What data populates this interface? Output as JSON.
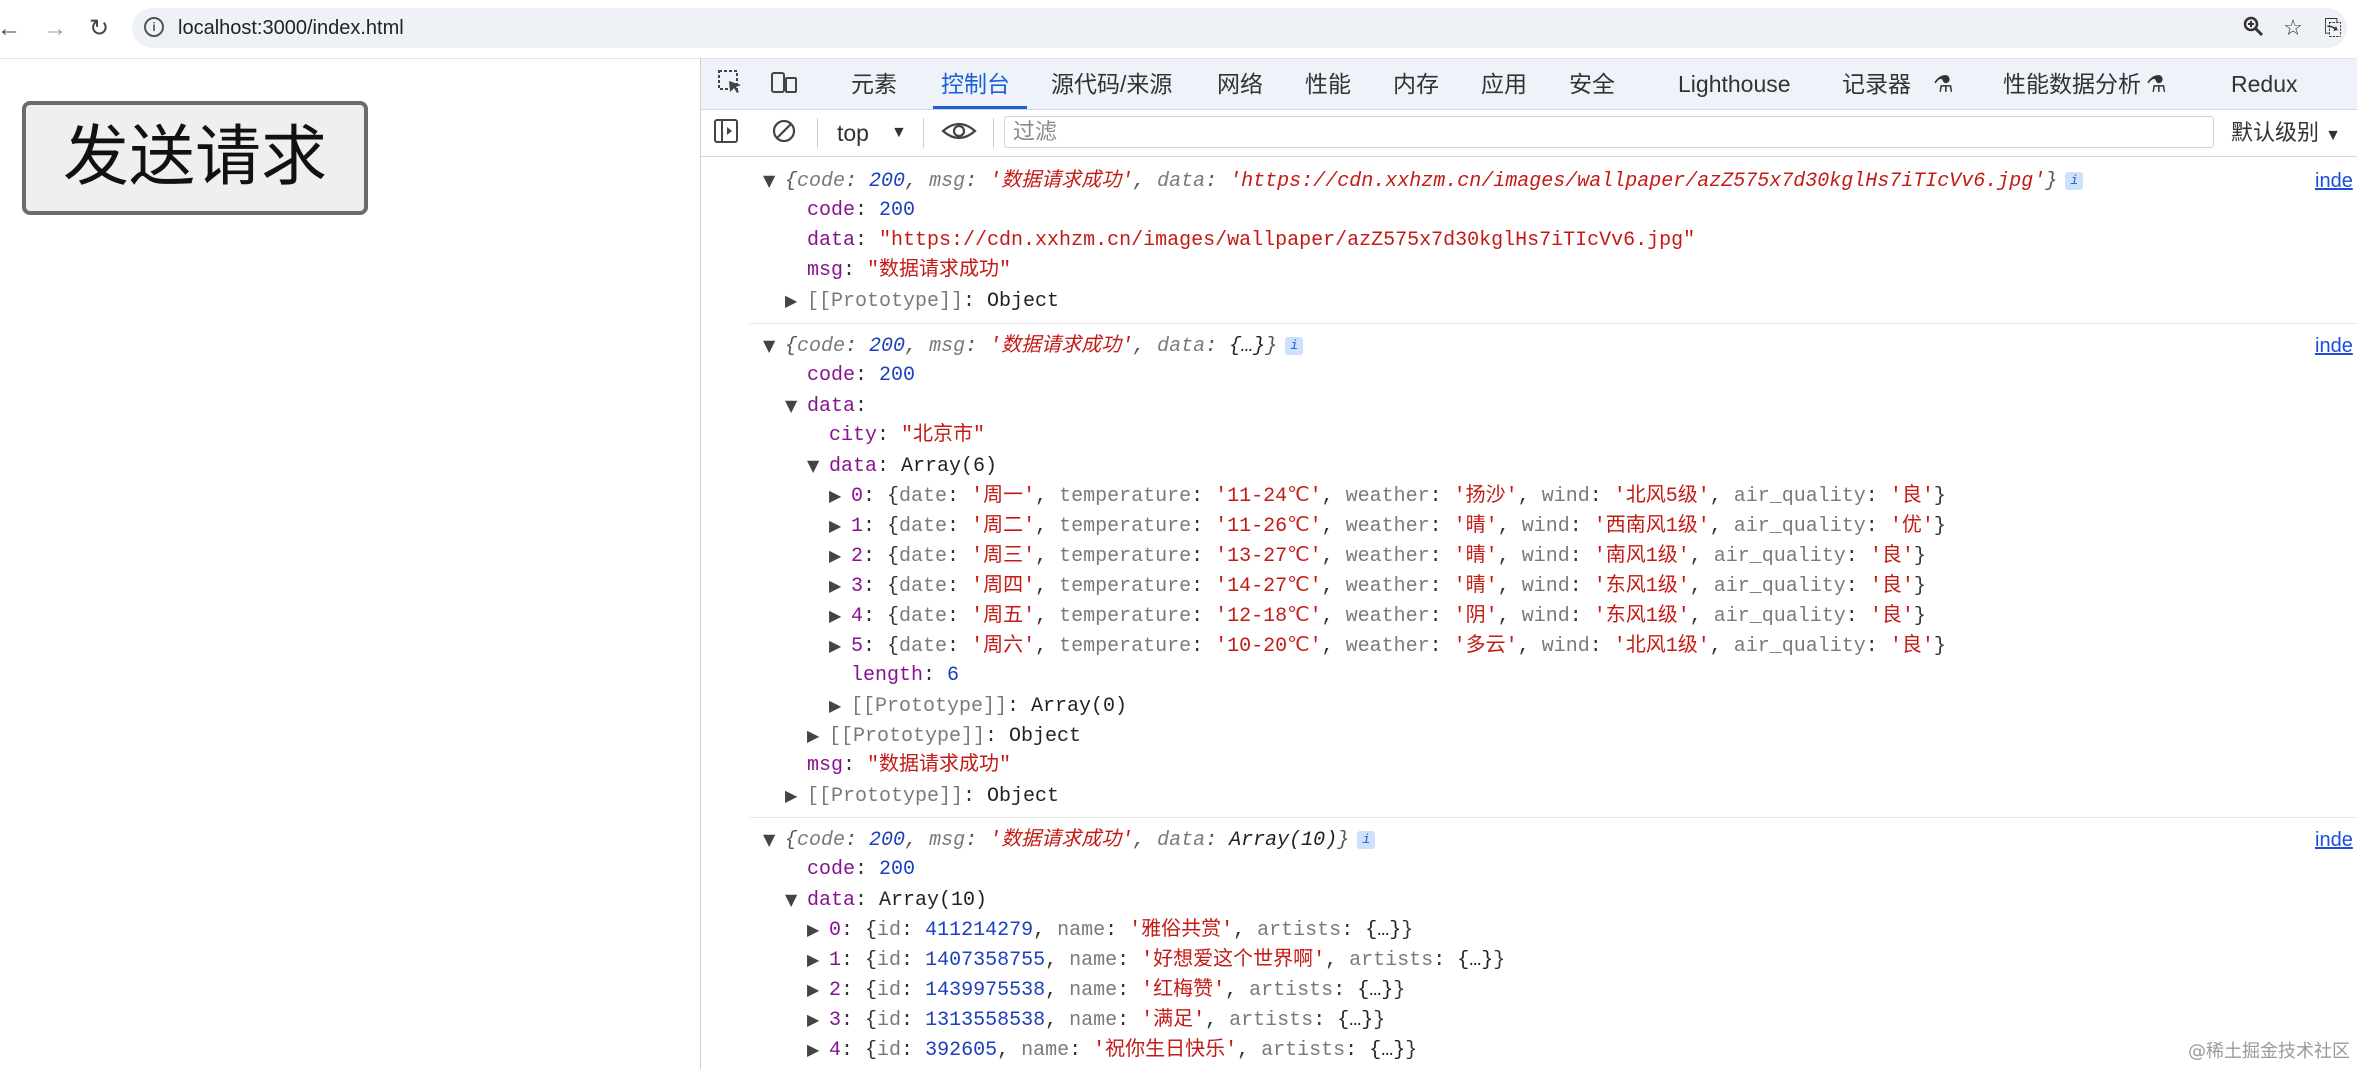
{
  "browser": {
    "url": "localhost:3000/index.html",
    "icons": {
      "back": "arrow-left-icon",
      "forward": "arrow-right-icon",
      "reload": "reload-icon",
      "site_info": "info-icon",
      "zoom": "zoom-icon",
      "bookmark": "star-icon"
    }
  },
  "page": {
    "send_button_label": "发送请求"
  },
  "devtools": {
    "tabs": [
      "元素",
      "控制台",
      "源代码/来源",
      "网络",
      "性能",
      "内存",
      "应用",
      "安全",
      "Lighthouse",
      "记录器",
      "性能数据分析",
      "Redux"
    ],
    "active_tab": "控制台",
    "context": "top",
    "filter_placeholder": "过滤",
    "log_level": "默认级别"
  },
  "console": {
    "source_link": "inde",
    "entry1": {
      "summary": {
        "code_val": "200",
        "msg_val": "'数据请求成功'",
        "data_val": "'https://cdn.xxhzm.cn/images/wallpaper/azZ575x7d30kglHs7iTIcVv6.jpg'"
      },
      "code": "200",
      "data": "\"https://cdn.xxhzm.cn/images/wallpaper/azZ575x7d30kglHs7iTIcVv6.jpg\"",
      "msg": "\"数据请求成功\"",
      "prototype": "Object"
    },
    "entry2": {
      "summary": {
        "code_val": "200",
        "msg_val": "'数据请求成功'",
        "data_val": "{…}"
      },
      "code": "200",
      "city": "\"北京市\"",
      "data_array": "Array(6)",
      "items": [
        {
          "idx": "0",
          "date": "'周一'",
          "temperature": "'11-24℃'",
          "weather": "'扬沙'",
          "wind": "'北风5级'",
          "air_quality": "'良'"
        },
        {
          "idx": "1",
          "date": "'周二'",
          "temperature": "'11-26℃'",
          "weather": "'晴'",
          "wind": "'西南风1级'",
          "air_quality": "'优'"
        },
        {
          "idx": "2",
          "date": "'周三'",
          "temperature": "'13-27℃'",
          "weather": "'晴'",
          "wind": "'南风1级'",
          "air_quality": "'良'"
        },
        {
          "idx": "3",
          "date": "'周四'",
          "temperature": "'14-27℃'",
          "weather": "'晴'",
          "wind": "'东风1级'",
          "air_quality": "'良'"
        },
        {
          "idx": "4",
          "date": "'周五'",
          "temperature": "'12-18℃'",
          "weather": "'阴'",
          "wind": "'东风1级'",
          "air_quality": "'良'"
        },
        {
          "idx": "5",
          "date": "'周六'",
          "temperature": "'10-20℃'",
          "weather": "'多云'",
          "wind": "'北风1级'",
          "air_quality": "'良'"
        }
      ],
      "length": "6",
      "array_prototype": "Array(0)",
      "inner_prototype": "Object",
      "msg": "\"数据请求成功\"",
      "prototype": "Object"
    },
    "entry3": {
      "summary": {
        "code_val": "200",
        "msg_val": "'数据请求成功'",
        "data_val": "Array(10)"
      },
      "code": "200",
      "data_array": "Array(10)",
      "items": [
        {
          "idx": "0",
          "id": "411214279",
          "name": "'雅俗共赏'",
          "artists": "{…}"
        },
        {
          "idx": "1",
          "id": "1407358755",
          "name": "'好想爱这个世界啊'",
          "artists": "{…}"
        },
        {
          "idx": "2",
          "id": "1439975538",
          "name": "'红梅赞'",
          "artists": "{…}"
        },
        {
          "idx": "3",
          "id": "1313558538",
          "name": "'满足'",
          "artists": "{…}"
        },
        {
          "idx": "4",
          "id": "392605",
          "name": "'祝你生日快乐'",
          "artists": "{…}"
        }
      ]
    },
    "watermark": "@稀土掘金技术社区"
  }
}
